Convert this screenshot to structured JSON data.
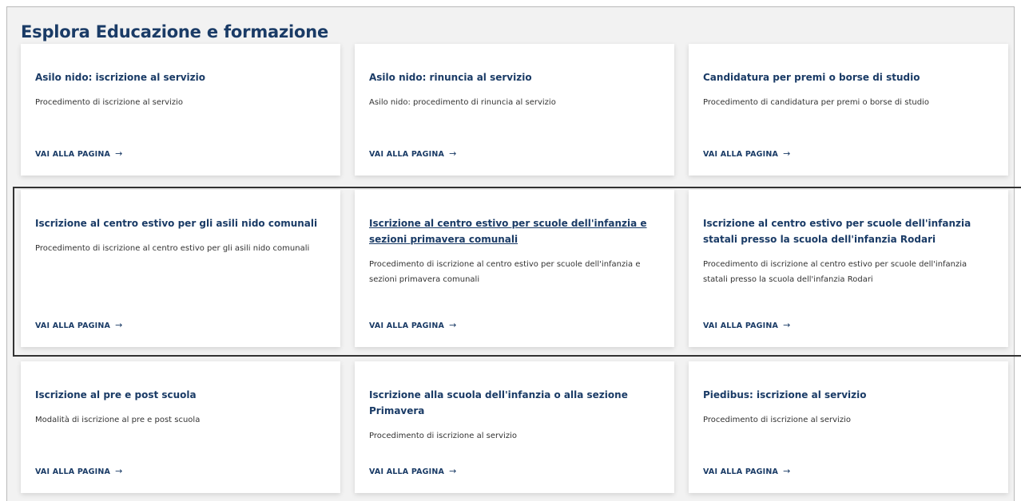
{
  "section": {
    "title": "Esplora Educazione e formazione"
  },
  "cards": [
    {
      "title": "Asilo nido: iscrizione al servizio",
      "description": "Procedimento di iscrizione al servizio",
      "link": "VAI ALLA PAGINA"
    },
    {
      "title": "Asilo nido: rinuncia al servizio",
      "description": "Asilo nido: procedimento di rinuncia al servizio",
      "link": "VAI ALLA PAGINA"
    },
    {
      "title": "Candidatura per premi o borse di studio",
      "description": "Procedimento di candidatura per premi o borse di studio",
      "link": "VAI ALLA PAGINA"
    },
    {
      "title": "Iscrizione al centro estivo per gli asili nido comunali",
      "description": "Procedimento di iscrizione al centro estivo per gli asili nido comunali",
      "link": "VAI ALLA PAGINA"
    },
    {
      "title": "Iscrizione al centro estivo per scuole dell'infanzia e sezioni primavera comunali",
      "description": "Procedimento di iscrizione al centro estivo per scuole dell'infanzia e sezioni primavera comunali",
      "link": "VAI ALLA PAGINA"
    },
    {
      "title": "Iscrizione al centro estivo per scuole dell'infanzia statali presso la scuola dell'infanzia Rodari",
      "description": "Procedimento di iscrizione al centro estivo per scuole dell'infanzia statali presso la scuola dell'infanzia Rodari",
      "link": "VAI ALLA PAGINA"
    },
    {
      "title": "Iscrizione al pre e post scuola",
      "description": "Modalità di iscrizione al pre e post scuola",
      "link": "VAI ALLA PAGINA"
    },
    {
      "title": "Iscrizione alla scuola dell'infanzia o alla sezione Primavera",
      "description": "Procedimento di iscrizione al servizio",
      "link": "VAI ALLA PAGINA"
    },
    {
      "title": "Piedibus: iscrizione al servizio",
      "description": "Procedimento di iscrizione al servizio",
      "link": "VAI ALLA PAGINA"
    }
  ],
  "icons": {
    "link_arrow": "arrow-right-icon"
  },
  "colors": {
    "primary": "#1a3b66",
    "text": "#333333",
    "background": "#f2f2f2",
    "card": "#ffffff"
  }
}
